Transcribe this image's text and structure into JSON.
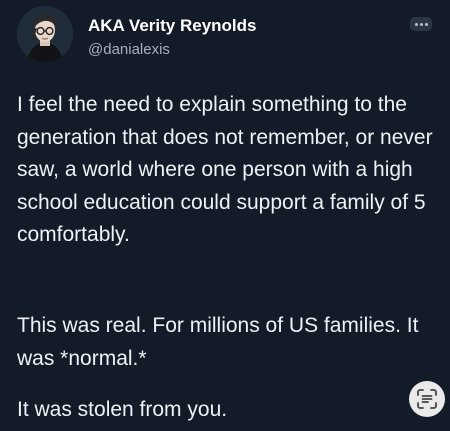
{
  "author": {
    "name": "AKA Verity Reynolds",
    "handle": "@danialexis",
    "avatar_icon": "person-illustration-icon"
  },
  "more_icon": "more-horizontal-icon",
  "tweet": {
    "paragraph_1": "I feel the need to explain something to the generation that does not remember, or never saw, a world where one person with a high school education could support a family of 5 comfortably.",
    "paragraph_2": "This was real. For millions of US families. It was *normal.*",
    "paragraph_3": "It was stolen from you."
  },
  "scan_icon": "text-scan-icon",
  "colors": {
    "background": "#121b27",
    "text": "#eef1f5",
    "handle": "#a7b0bb"
  }
}
